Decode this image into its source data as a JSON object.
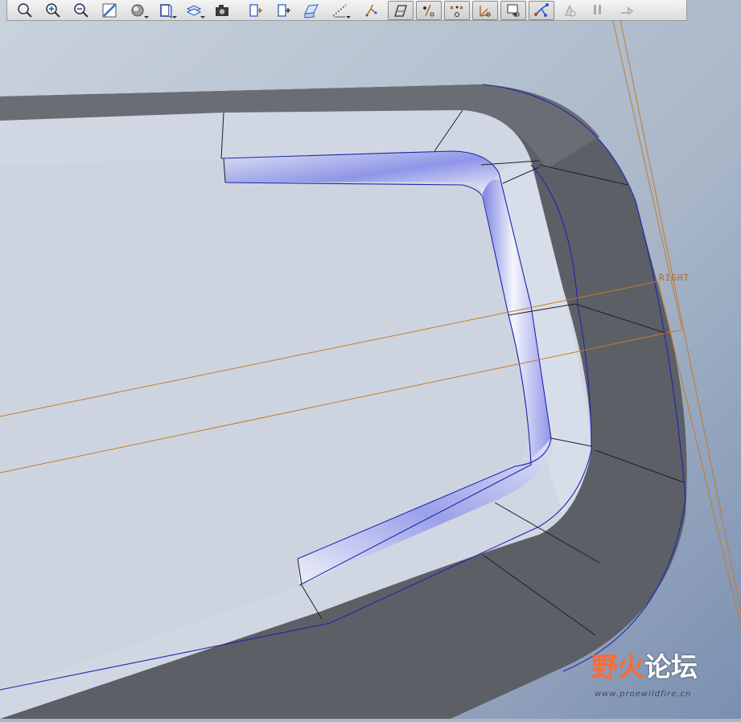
{
  "toolbar": {
    "buttons": [
      {
        "id": "refit",
        "icon": "magnifier-refit-icon"
      },
      {
        "id": "zoom-in",
        "icon": "zoom-in-icon"
      },
      {
        "id": "zoom-out",
        "icon": "zoom-out-icon"
      },
      {
        "id": "repaint",
        "icon": "repaint-icon"
      },
      {
        "id": "display-style",
        "icon": "shaded-sphere-icon"
      },
      {
        "id": "saved-views",
        "icon": "saved-view-icon"
      },
      {
        "id": "layers",
        "icon": "layer-icon"
      },
      {
        "id": "camera",
        "icon": "camera-icon"
      },
      {
        "id": "datum-planes",
        "icon": "datum-plane-icon"
      },
      {
        "id": "datum-axes",
        "icon": "datum-axis-icon"
      },
      {
        "id": "datum-points",
        "icon": "datum-point-icon"
      },
      {
        "id": "coordinate-systems",
        "icon": "coordinate-system-icon"
      },
      {
        "id": "show-planes",
        "icon": "plane-toggle-icon",
        "pressed": true
      },
      {
        "id": "show-axes",
        "icon": "axis-toggle-icon",
        "pressed": true
      },
      {
        "id": "show-points",
        "icon": "point-toggle-icon",
        "pressed": true
      },
      {
        "id": "show-csys",
        "icon": "csys-toggle-icon",
        "pressed": true
      },
      {
        "id": "annotation",
        "icon": "annotation-toggle-icon",
        "pressed": true
      },
      {
        "id": "spin-center",
        "icon": "spin-center-icon",
        "pressed": true
      },
      {
        "id": "regenerate",
        "icon": "regenerate-icon"
      },
      {
        "id": "pause",
        "icon": "pause-icon"
      },
      {
        "id": "next",
        "icon": "next-icon"
      }
    ]
  },
  "viewport": {
    "datum_label": "RIGHT",
    "colors": {
      "background_top": "#c7d4df",
      "background_bottom": "#7f94b1",
      "dark_wall": "#5d6065",
      "wall_edge": "#2e3036",
      "light_face": "#d3dae6",
      "blend_highlight": "#8f95e8",
      "datum_line": "#c47a2c",
      "edge_blue": "#1f24b0"
    }
  },
  "watermark": {
    "main_a": "野火",
    "main_b": "论坛",
    "url": "www.proewildfire.cn"
  }
}
